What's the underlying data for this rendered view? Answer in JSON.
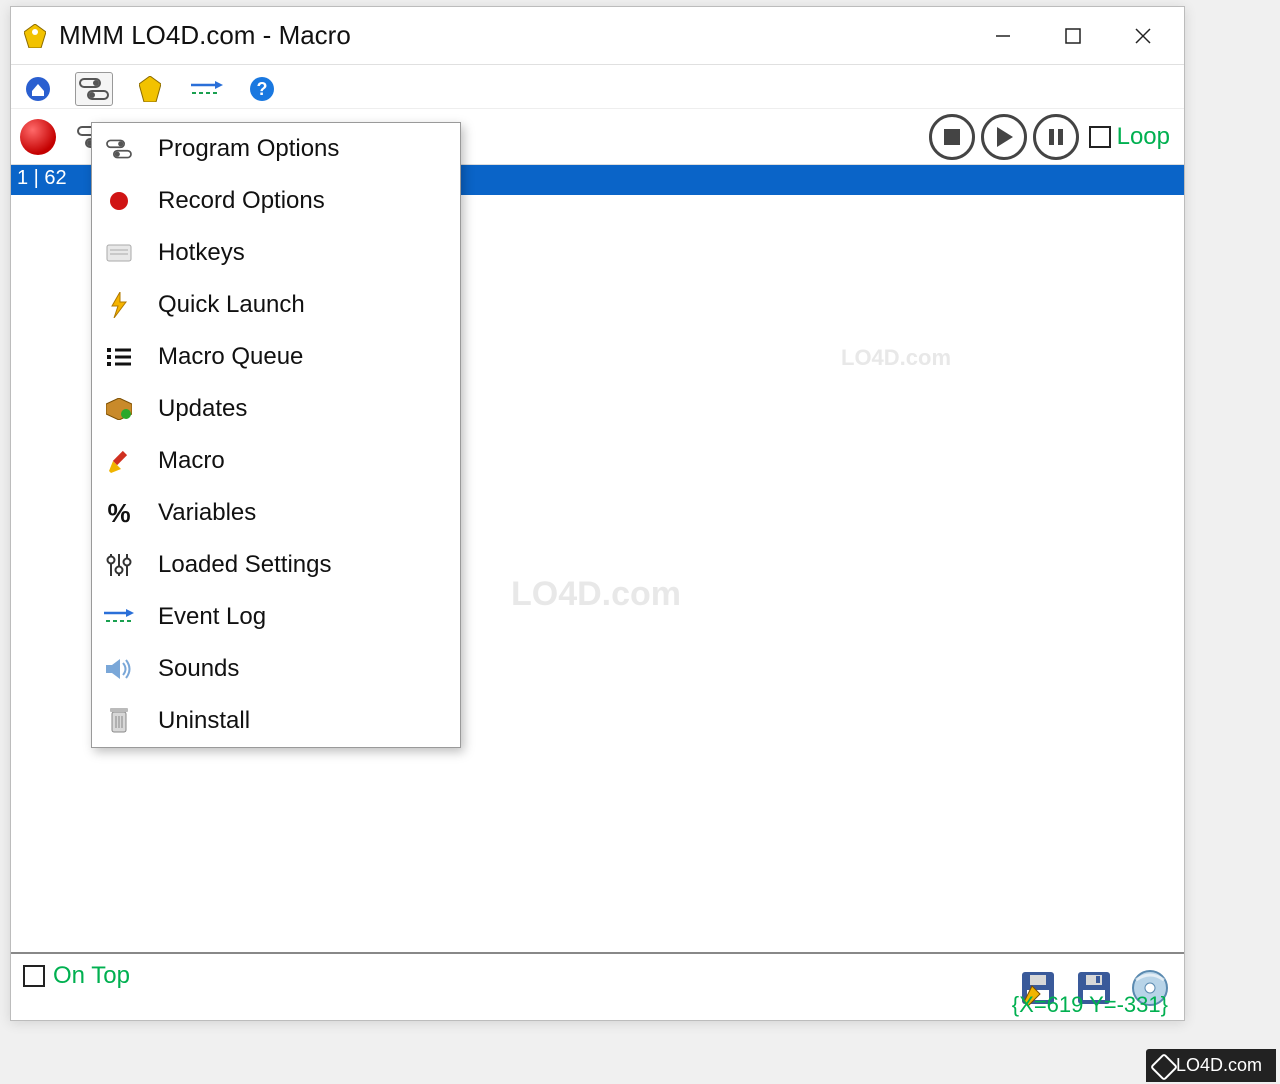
{
  "window": {
    "title": "MMM LO4D.com - Macro"
  },
  "toolbar2": {
    "loop_label": "Loop"
  },
  "list": {
    "selected_row": "1 | 62"
  },
  "menu": {
    "items": [
      {
        "icon": "toggles-icon",
        "label": "Program Options"
      },
      {
        "icon": "record-icon",
        "label": "Record Options"
      },
      {
        "icon": "keyboard-icon",
        "label": "Hotkeys"
      },
      {
        "icon": "lightning-icon",
        "label": "Quick Launch"
      },
      {
        "icon": "list-icon",
        "label": "Macro Queue"
      },
      {
        "icon": "package-icon",
        "label": "Updates"
      },
      {
        "icon": "pencil-icon",
        "label": "Macro"
      },
      {
        "icon": "percent-icon",
        "label": "Variables"
      },
      {
        "icon": "sliders-icon",
        "label": "Loaded Settings"
      },
      {
        "icon": "arrow-log-icon",
        "label": "Event Log"
      },
      {
        "icon": "speaker-icon",
        "label": "Sounds"
      },
      {
        "icon": "trash-icon",
        "label": "Uninstall"
      }
    ]
  },
  "bottom": {
    "ontop_label": "On Top",
    "coords": "{X=619 Y=-331}"
  },
  "watermark": {
    "text": "LO4D.com"
  },
  "footer": {
    "text": "LO4D.com"
  }
}
